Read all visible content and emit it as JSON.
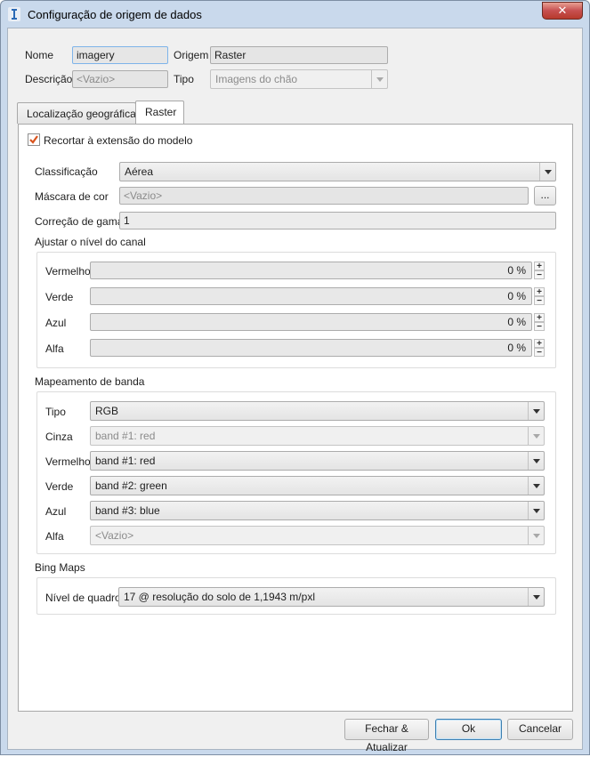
{
  "window": {
    "title": "Configuração de origem de dados",
    "close_glyph": "✕"
  },
  "header": {
    "name_label": "Nome",
    "name_value": "imagery",
    "origin_label": "Origem",
    "origin_value": "Raster",
    "description_label": "Descrição",
    "description_value": "<Vazio>",
    "type_label": "Tipo",
    "type_value": "Imagens do chão"
  },
  "tabs": [
    {
      "label": "Localização geográfica",
      "active": false
    },
    {
      "label": "Raster",
      "active": true
    }
  ],
  "raster": {
    "clip_label": "Recortar à extensão do modelo",
    "clip_checked": true,
    "classification_label": "Classificação",
    "classification_value": "Aérea",
    "color_mask_label": "Máscara de cor",
    "color_mask_value": "<Vazio>",
    "browse_label": "...",
    "gamma_label": "Correção de gama",
    "gamma_value": "1",
    "channel_group_title": "Ajustar o nível do canal",
    "channels": [
      {
        "label": "Vermelho",
        "value": "0 %"
      },
      {
        "label": "Verde",
        "value": "0 %"
      },
      {
        "label": "Azul",
        "value": "0 %"
      },
      {
        "label": "Alfa",
        "value": "0 %"
      }
    ],
    "band_group_title": "Mapeamento de banda",
    "bands": [
      {
        "label": "Tipo",
        "value": "RGB",
        "disabled": false
      },
      {
        "label": "Cinza",
        "value": "band #1: red",
        "disabled": true
      },
      {
        "label": "Vermelho",
        "value": "band #1: red",
        "disabled": false
      },
      {
        "label": "Verde",
        "value": "band #2: green",
        "disabled": false
      },
      {
        "label": "Azul",
        "value": "band #3: blue",
        "disabled": false
      },
      {
        "label": "Alfa",
        "value": "<Vazio>",
        "disabled": true
      }
    ],
    "bing_group_title": "Bing Maps",
    "zoom_label": "Nível de quadro",
    "zoom_value": "17 @ resolução do solo de 1,1943 m/pxl"
  },
  "buttons": {
    "close_update": "Fechar & Atualizar",
    "ok": "Ok",
    "cancel": "Cancelar"
  },
  "colors": {
    "title_bg": "#c9d9ec",
    "checkbox_check": "#d9541e",
    "close_btn": "#c75050"
  }
}
